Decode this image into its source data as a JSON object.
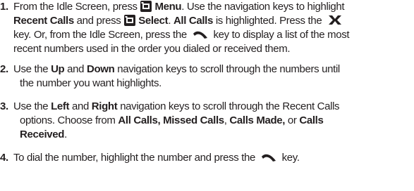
{
  "steps": [
    {
      "number": "1.",
      "l1_a": "From the Idle Screen, press ",
      "l1_b": "Menu",
      "l1_c": ". Use the navigation keys to highlight",
      "l2_a": "Recent Calls",
      "l2_b": " and press ",
      "l2_c": "Select",
      "l2_d": ". ",
      "l2_e": "All Calls",
      "l2_f": " is highlighted. Press the ",
      "l3_a": "key. Or, from the Idle Screen, press the ",
      "l3_b": " key to display a list of the most",
      "l4": "recent numbers used in the order you dialed or received them."
    },
    {
      "number": "2.",
      "l1_a": "Use the ",
      "l1_b": "Up",
      "l1_c": " and ",
      "l1_d": "Down",
      "l1_e": " navigation keys to scroll through the numbers until",
      "l2": "the number you want highlights."
    },
    {
      "number": "3.",
      "l1_a": "Use the ",
      "l1_b": "Left",
      "l1_c": " and ",
      "l1_d": "Right",
      "l1_e": " navigation keys to scroll through the Recent Calls",
      "l2_a": "options. Choose from ",
      "l2_b": "All Calls, Missed Calls",
      "l2_c": ", ",
      "l2_d": "Calls Made,",
      "l2_e": " or ",
      "l2_f": "Calls",
      "l3": "Received",
      "l3_end": "."
    },
    {
      "number": "4.",
      "l1_a": "To dial the number, highlight the number and press the ",
      "l1_b": " key."
    }
  ],
  "icons": {
    "menu_key": "left-softkey-icon",
    "select_key": "left-softkey-icon",
    "end_key": "end-key-icon",
    "send_key": "send-key-icon"
  },
  "colors": {
    "text": "#231f20",
    "background": "#ffffff"
  }
}
